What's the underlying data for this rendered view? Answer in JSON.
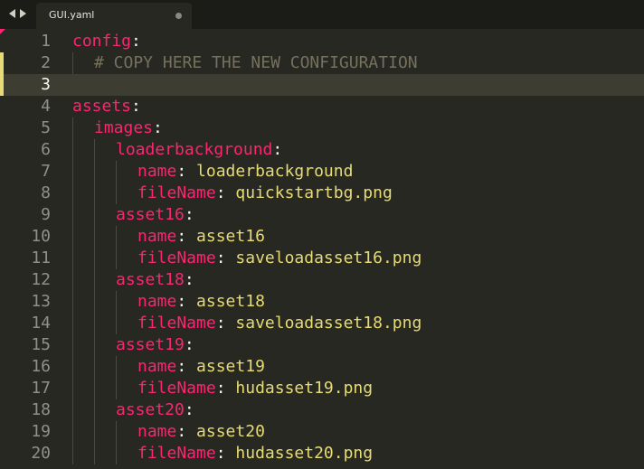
{
  "tab": {
    "title": "GUI.yaml",
    "dirty": true
  },
  "colors": {
    "background": "#272822",
    "key": "#f92672",
    "value": "#e6db74",
    "comment": "#75715e",
    "text": "#f8f8f2",
    "line_number": "#90908a"
  },
  "editor": {
    "current_line": 3,
    "lines": [
      {
        "num": "1",
        "indent": 0,
        "key": "config",
        "sep": ":",
        "value": "",
        "comment": ""
      },
      {
        "num": "2",
        "indent": 1,
        "key": "",
        "sep": "",
        "value": "",
        "comment": "# COPY HERE THE NEW CONFIGURATION"
      },
      {
        "num": "3",
        "indent": 0,
        "key": "",
        "sep": "",
        "value": "",
        "comment": ""
      },
      {
        "num": "4",
        "indent": 0,
        "key": "assets",
        "sep": ":",
        "value": "",
        "comment": ""
      },
      {
        "num": "5",
        "indent": 1,
        "key": "images",
        "sep": ":",
        "value": "",
        "comment": ""
      },
      {
        "num": "6",
        "indent": 2,
        "key": "loaderbackground",
        "sep": ":",
        "value": "",
        "comment": ""
      },
      {
        "num": "7",
        "indent": 3,
        "key": "name",
        "sep": ": ",
        "value": "loaderbackground",
        "comment": ""
      },
      {
        "num": "8",
        "indent": 3,
        "key": "fileName",
        "sep": ": ",
        "value": "quickstartbg.png",
        "comment": ""
      },
      {
        "num": "9",
        "indent": 2,
        "key": "asset16",
        "sep": ":",
        "value": "",
        "comment": ""
      },
      {
        "num": "10",
        "indent": 3,
        "key": "name",
        "sep": ": ",
        "value": "asset16",
        "comment": ""
      },
      {
        "num": "11",
        "indent": 3,
        "key": "fileName",
        "sep": ": ",
        "value": "saveloadasset16.png",
        "comment": ""
      },
      {
        "num": "12",
        "indent": 2,
        "key": "asset18",
        "sep": ":",
        "value": "",
        "comment": ""
      },
      {
        "num": "13",
        "indent": 3,
        "key": "name",
        "sep": ": ",
        "value": "asset18",
        "comment": ""
      },
      {
        "num": "14",
        "indent": 3,
        "key": "fileName",
        "sep": ": ",
        "value": "saveloadasset18.png",
        "comment": ""
      },
      {
        "num": "15",
        "indent": 2,
        "key": "asset19",
        "sep": ":",
        "value": "",
        "comment": ""
      },
      {
        "num": "16",
        "indent": 3,
        "key": "name",
        "sep": ": ",
        "value": "asset19",
        "comment": ""
      },
      {
        "num": "17",
        "indent": 3,
        "key": "fileName",
        "sep": ": ",
        "value": "hudasset19.png",
        "comment": ""
      },
      {
        "num": "18",
        "indent": 2,
        "key": "asset20",
        "sep": ":",
        "value": "",
        "comment": ""
      },
      {
        "num": "19",
        "indent": 3,
        "key": "name",
        "sep": ": ",
        "value": "asset20",
        "comment": ""
      },
      {
        "num": "20",
        "indent": 3,
        "key": "fileName",
        "sep": ": ",
        "value": "hudasset20.png",
        "comment": ""
      }
    ]
  }
}
